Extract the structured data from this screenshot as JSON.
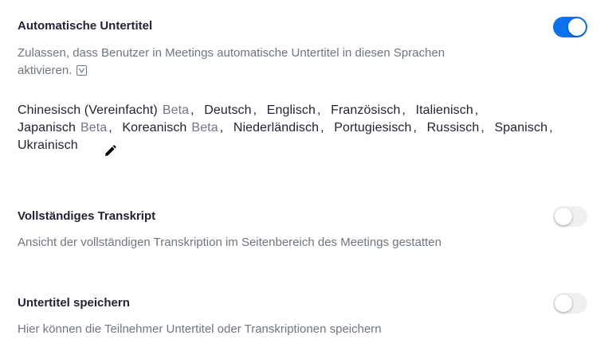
{
  "auto_captions": {
    "title": "Automatische Untertitel",
    "description_line1": "Zulassen, dass Benutzer in Meetings automatische Untertitel in diesen Sprachen",
    "description_line2": "aktivieren.",
    "toggle_on": true,
    "accent_color": "#0e72ed",
    "languages": [
      {
        "name": "Chinesisch (Vereinfacht)",
        "beta": "Beta"
      },
      {
        "name": "Deutsch",
        "beta": ""
      },
      {
        "name": "Englisch",
        "beta": ""
      },
      {
        "name": "Französisch",
        "beta": ""
      },
      {
        "name": "Italienisch",
        "beta": ""
      },
      {
        "name": "Japanisch",
        "beta": "Beta"
      },
      {
        "name": "Koreanisch",
        "beta": "Beta"
      },
      {
        "name": "Niederländisch",
        "beta": ""
      },
      {
        "name": "Portugiesisch",
        "beta": ""
      },
      {
        "name": "Russisch",
        "beta": ""
      },
      {
        "name": "Spanisch",
        "beta": ""
      },
      {
        "name": "Ukrainisch",
        "beta": ""
      }
    ],
    "edit_icon": "pencil-icon",
    "info_icon": "info-icon"
  },
  "full_transcript": {
    "title": "Vollständiges Transkript",
    "description": "Ansicht der vollständigen Transkription im Seitenbereich des Meetings gestatten",
    "toggle_on": false
  },
  "save_captions": {
    "title": "Untertitel speichern",
    "description": "Hier können die Teilnehmer Untertitel oder Transkriptionen speichern",
    "toggle_on": false
  }
}
